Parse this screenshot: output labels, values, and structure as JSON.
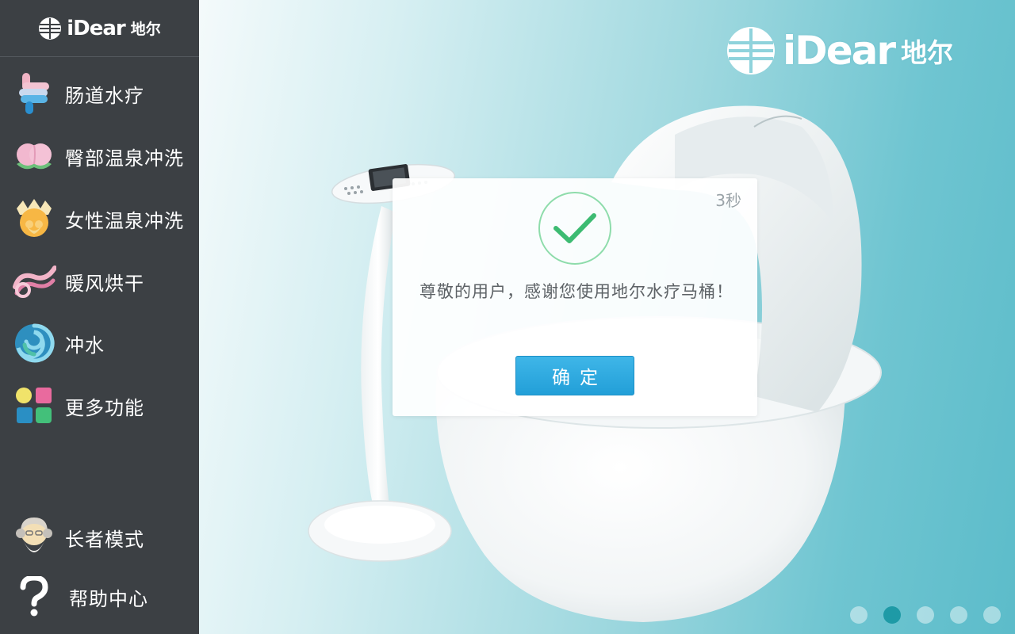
{
  "brand": {
    "logo_text": "iDear",
    "logo_cn": "地尔"
  },
  "sidebar": {
    "items": [
      {
        "label": "肠道水疗",
        "icon": "intestine-icon"
      },
      {
        "label": "臀部温泉冲洗",
        "icon": "peach-icon"
      },
      {
        "label": "女性温泉冲洗",
        "icon": "lotus-icon"
      },
      {
        "label": "暖风烘干",
        "icon": "wind-icon"
      },
      {
        "label": "冲水",
        "icon": "swirl-icon"
      },
      {
        "label": "更多功能",
        "icon": "grid-icon"
      },
      {
        "label": "长者模式",
        "icon": "elder-icon"
      },
      {
        "label": "帮助中心",
        "icon": "question-icon"
      }
    ]
  },
  "dialog": {
    "countdown": "3秒",
    "message": "尊敬的用户，感谢您使用地尔水疗马桶！",
    "ok_label": "确定"
  },
  "pager": {
    "count": 5,
    "active_index": 1
  },
  "colors": {
    "sidebar_bg": "#3c4044",
    "accent_teal": "#1e9aa6",
    "button_blue": "#2aa8df",
    "check_green": "#3dbb72"
  }
}
